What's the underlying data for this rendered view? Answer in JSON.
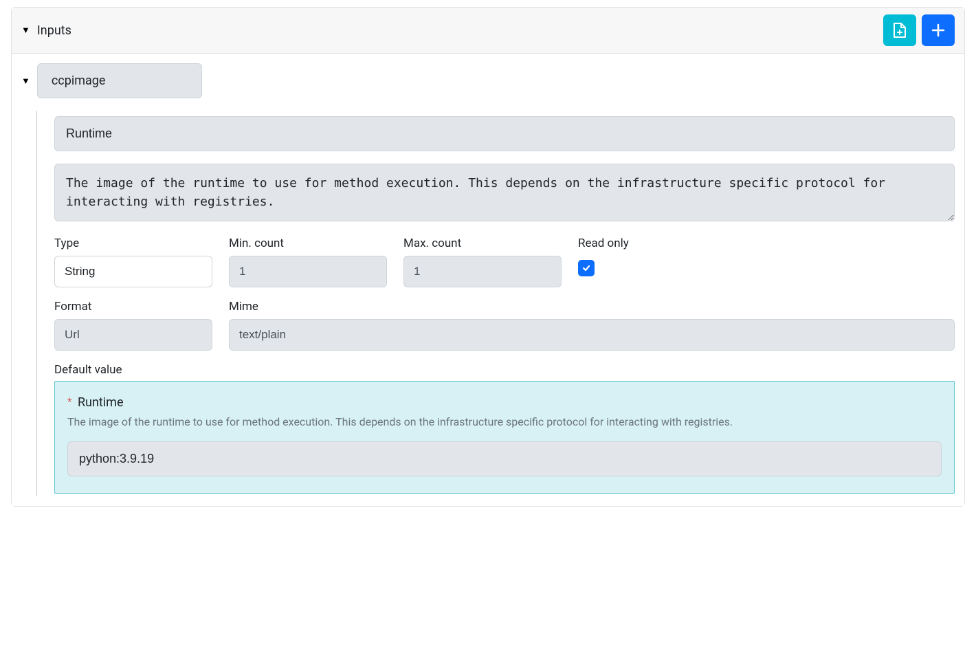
{
  "section": {
    "title": "Inputs"
  },
  "entry": {
    "name": "ccpimage",
    "title": "Runtime",
    "description": "The image of the runtime to use for method execution. This depends on the infrastructure specific protocol for interacting with registries.",
    "fields": {
      "type": {
        "label": "Type",
        "value": "String"
      },
      "min_count": {
        "label": "Min. count",
        "value": "1"
      },
      "max_count": {
        "label": "Max. count",
        "value": "1"
      },
      "read_only": {
        "label": "Read only",
        "checked": true
      },
      "format": {
        "label": "Format",
        "value": "Url"
      },
      "mime": {
        "label": "Mime",
        "value": "text/plain"
      }
    },
    "default_value": {
      "label": "Default value",
      "title": "Runtime",
      "description": "The image of the runtime to use for method execution. This depends on the infrastructure specific protocol for interacting with registries.",
      "value": "python:3.9.19"
    }
  }
}
